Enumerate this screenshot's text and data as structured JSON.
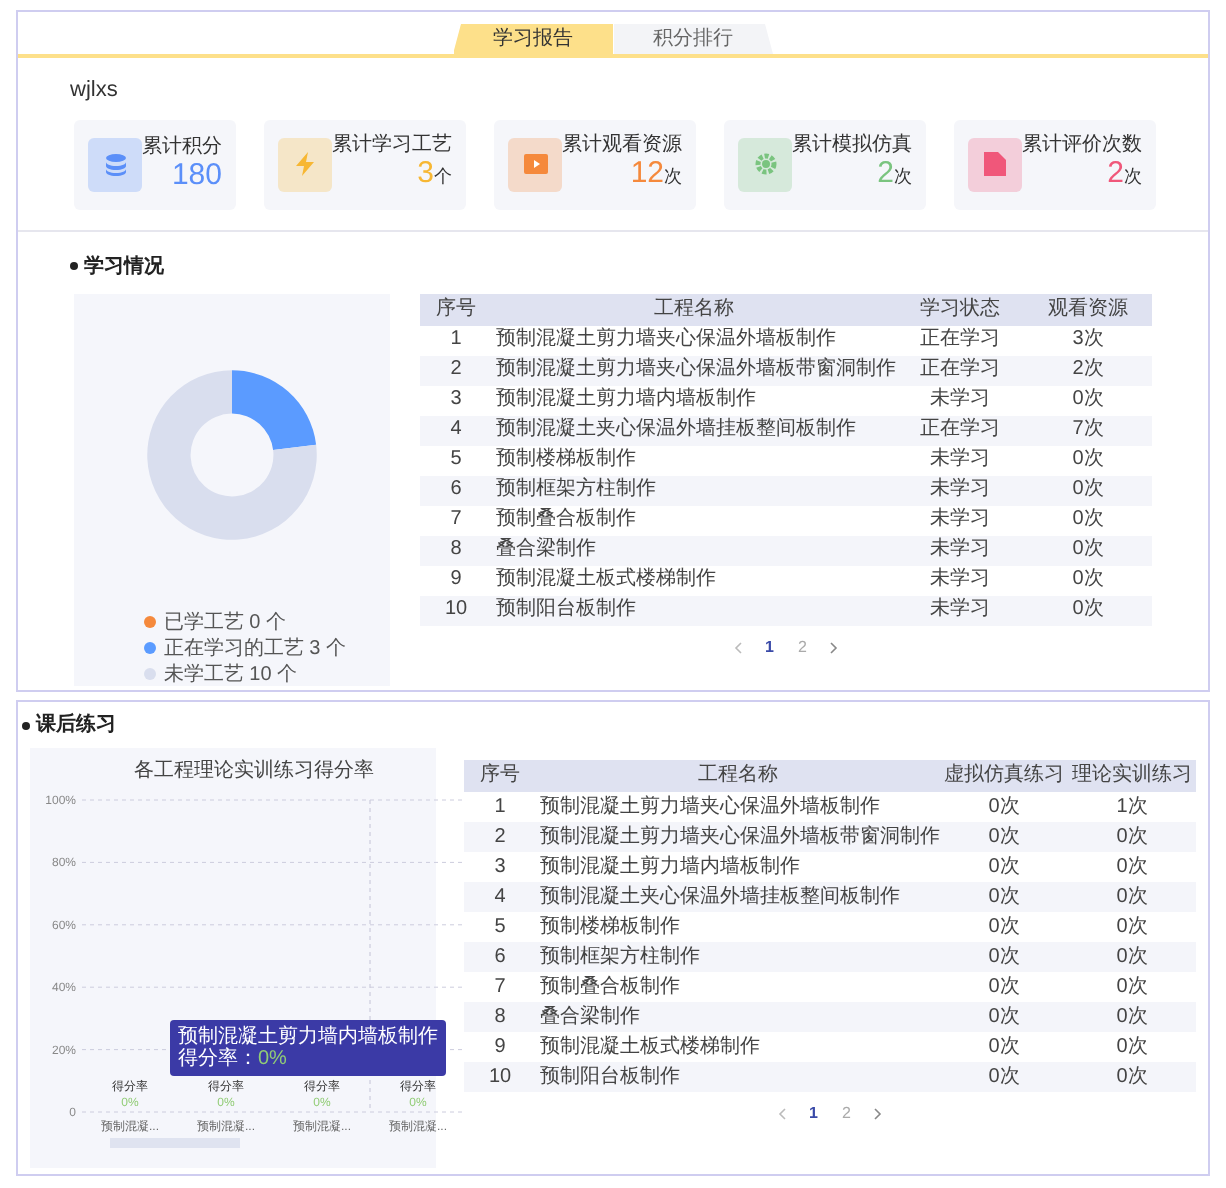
{
  "tabs": [
    {
      "label": "学习报告",
      "selected": true
    },
    {
      "label": "积分排行",
      "selected": false
    }
  ],
  "user": "wjlxs",
  "stats": [
    {
      "kind": "coins",
      "label": "累计积分",
      "value": "180",
      "color": "#5b8ff9"
    },
    {
      "kind": "bolt",
      "label": "累计学习工艺",
      "value": "3",
      "unit": "个",
      "color": "#f7b733"
    },
    {
      "kind": "play",
      "label": "累计观看资源",
      "value": "12",
      "unit": "次",
      "color": "#f5893c"
    },
    {
      "kind": "gear",
      "label": "累计模拟仿真",
      "value": "2",
      "unit": "次",
      "color": "#7ac47f"
    },
    {
      "kind": "doc",
      "label": "累计评价次数",
      "value": "2",
      "unit": "次",
      "color": "#f0577a"
    }
  ],
  "study": {
    "title": "学习情况",
    "chart_data": {
      "type": "donut",
      "categories": [
        "已学工艺 0 个",
        "正在学习的工艺 3 个",
        "未学工艺 10 个"
      ],
      "values": [
        0,
        3,
        10
      ],
      "colors": [
        "#f5893c",
        "#5b9bff",
        "#d9deee"
      ],
      "legend": "bottom-right"
    },
    "columns": [
      "序号",
      "工程名称",
      "学习状态",
      "观看资源"
    ],
    "rows": [
      [
        "1",
        "预制混凝土剪力墙夹心保温外墙板制作",
        "正在学习",
        "3次"
      ],
      [
        "2",
        "预制混凝土剪力墙夹心保温外墙板带窗洞制作",
        "正在学习",
        "2次"
      ],
      [
        "3",
        "预制混凝土剪力墙内墙板制作",
        "未学习",
        "0次"
      ],
      [
        "4",
        "预制混凝土夹心保温外墙挂板整间板制作",
        "正在学习",
        "7次"
      ],
      [
        "5",
        "预制楼梯板制作",
        "未学习",
        "0次"
      ],
      [
        "6",
        "预制框架方柱制作",
        "未学习",
        "0次"
      ],
      [
        "7",
        "预制叠合板制作",
        "未学习",
        "0次"
      ],
      [
        "8",
        "叠合梁制作",
        "未学习",
        "0次"
      ],
      [
        "9",
        "预制混凝土板式楼梯制作",
        "未学习",
        "0次"
      ],
      [
        "10",
        "预制阳台板制作",
        "未学习",
        "0次"
      ]
    ],
    "pages": [
      {
        "label": "1",
        "selected": true
      },
      {
        "label": "2",
        "selected": false
      }
    ]
  },
  "practice": {
    "title": "课后练习",
    "chart_data": {
      "type": "bar",
      "title": "各工程理论实训练习得分率",
      "categories": [
        "预制混凝...",
        "预制混凝...",
        "预制混凝...",
        "预制混凝..."
      ],
      "series": [
        {
          "name": "得分率",
          "values": [
            0,
            0,
            0,
            0
          ]
        }
      ],
      "ylim": [
        0,
        100
      ],
      "yticks": [
        {
          "value": 0,
          "label": "0"
        },
        {
          "value": 20,
          "label": "20%"
        },
        {
          "value": 40,
          "label": "40%"
        },
        {
          "value": 60,
          "label": "60%"
        },
        {
          "value": 80,
          "label": "80%"
        },
        {
          "value": 100,
          "label": "100%"
        }
      ],
      "value_labels": [
        "0%",
        "0%",
        "0%",
        "0%"
      ],
      "grid": true
    },
    "tooltip": {
      "title": "预制混凝土剪力墙内墙板制作",
      "label": "得分率：",
      "value": "0%"
    },
    "columns": [
      "序号",
      "工程名称",
      "虚拟仿真练习",
      "理论实训练习"
    ],
    "rows": [
      [
        "1",
        "预制混凝土剪力墙夹心保温外墙板制作",
        "0次",
        "1次"
      ],
      [
        "2",
        "预制混凝土剪力墙夹心保温外墙板带窗洞制作",
        "0次",
        "0次"
      ],
      [
        "3",
        "预制混凝土剪力墙内墙板制作",
        "0次",
        "0次"
      ],
      [
        "4",
        "预制混凝土夹心保温外墙挂板整间板制作",
        "0次",
        "0次"
      ],
      [
        "5",
        "预制楼梯板制作",
        "0次",
        "0次"
      ],
      [
        "6",
        "预制框架方柱制作",
        "0次",
        "0次"
      ],
      [
        "7",
        "预制叠合板制作",
        "0次",
        "0次"
      ],
      [
        "8",
        "叠合梁制作",
        "0次",
        "0次"
      ],
      [
        "9",
        "预制混凝土板式楼梯制作",
        "0次",
        "0次"
      ],
      [
        "10",
        "预制阳台板制作",
        "0次",
        "0次"
      ]
    ],
    "pages": [
      {
        "label": "1",
        "selected": true
      },
      {
        "label": "2",
        "selected": false
      }
    ]
  }
}
